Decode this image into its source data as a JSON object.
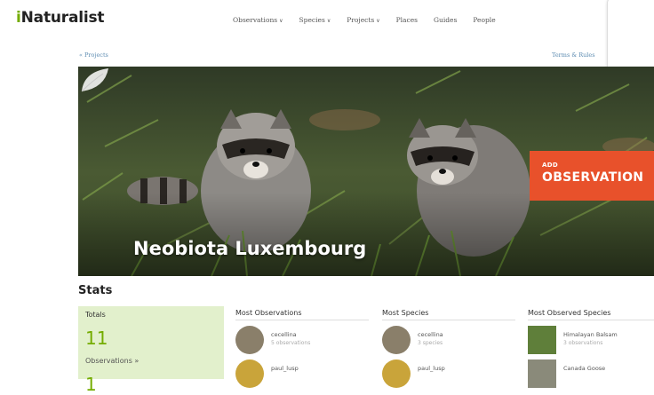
{
  "brand": {
    "logo_i": "i",
    "logo_rest": "Naturalist"
  },
  "nav": [
    {
      "label": "Observations",
      "caret": "∨"
    },
    {
      "label": "Species",
      "caret": "∨"
    },
    {
      "label": "Projects",
      "caret": "∨"
    },
    {
      "label": "Places",
      "caret": ""
    },
    {
      "label": "Guides",
      "caret": ""
    },
    {
      "label": "People",
      "caret": ""
    }
  ],
  "breadcrumb": {
    "back_label": "« Projects",
    "terms_label": "Terms & Rules"
  },
  "project": {
    "title": "Neobiota Luxembourg",
    "add_observation": {
      "small": "ADD",
      "big": "OBSERVATION"
    }
  },
  "stats": {
    "title": "Stats",
    "totals": {
      "label": "Totals",
      "observations_count": "11",
      "observations_label": "Observations »",
      "next_count": "1"
    },
    "most_observations": {
      "header": "Most Observations",
      "rows": [
        {
          "name": "cecellina",
          "meta": "5 observations"
        },
        {
          "name": "paul_lusp",
          "meta": ""
        }
      ]
    },
    "most_species": {
      "header": "Most Species",
      "rows": [
        {
          "name": "cecellina",
          "meta": "3 species"
        },
        {
          "name": "paul_lusp",
          "meta": ""
        }
      ]
    },
    "most_observed_species": {
      "header": "Most Observed Species",
      "rows": [
        {
          "name": "Himalayan Balsam",
          "meta": "3 observations"
        },
        {
          "name": "Canada Goose",
          "meta": ""
        }
      ]
    }
  },
  "colors": {
    "brand_green": "#74ac00",
    "accent_orange": "#e8512b",
    "totals_bg": "#e2f0cc"
  }
}
